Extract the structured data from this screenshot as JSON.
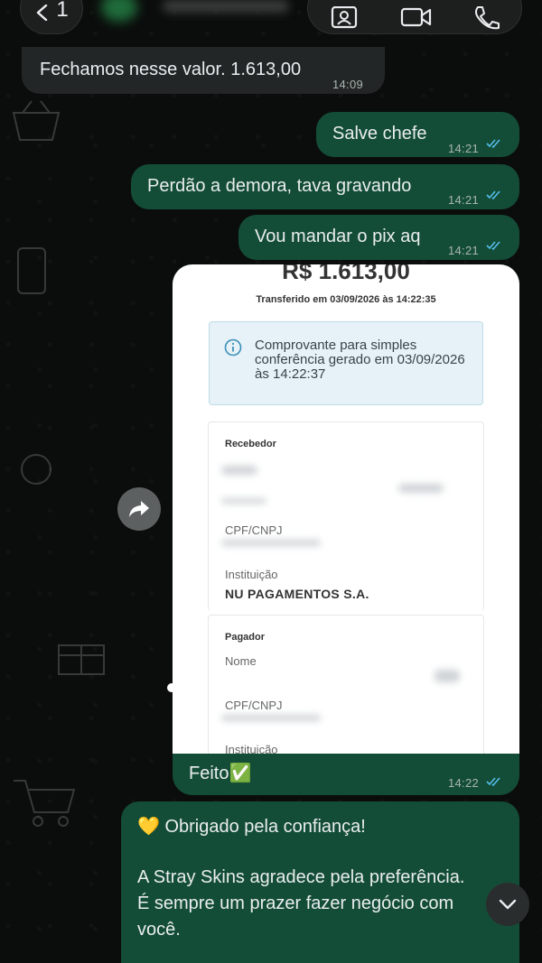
{
  "header": {
    "back_count": "1",
    "icons": [
      "chevron-left-icon",
      "contact-card-icon",
      "video-call-icon",
      "phone-call-icon"
    ]
  },
  "messages": [
    {
      "direction": "in",
      "text": "Fechamos nesse valor. 1.613,00",
      "time": "14:09"
    },
    {
      "direction": "out",
      "text": "Salve chefe",
      "time": "14:21",
      "status": "read"
    },
    {
      "direction": "out",
      "text": "Perdão a demora, tava gravando",
      "time": "14:21",
      "status": "read"
    },
    {
      "direction": "out",
      "text": "Vou mandar o pix aq",
      "time": "14:21",
      "status": "read"
    }
  ],
  "receipt": {
    "amount": "R$ 1.613,00",
    "transfer_date": "Transferido em 03/09/2026 às 14:22:35",
    "info_text": "Comprovante para simples conferência gerado em 03/09/2026 às 14:22:37",
    "recebedor": {
      "section": "Recebedor",
      "cpf_label": "CPF/CNPJ",
      "inst_label": "Instituição",
      "inst_value": "NU PAGAMENTOS S.A."
    },
    "pagador": {
      "section": "Pagador",
      "name_label": "Nome",
      "cpf_label": "CPF/CNPJ",
      "inst_label": "Instituição"
    },
    "caption": "Feito✅",
    "time": "14:22",
    "status": "read"
  },
  "last_message": {
    "line1": "💛 Obrigado pela confiança!",
    "line2": "A Stray Skins agradece pela preferência.",
    "line3": "É sempre um prazer fazer negócio com",
    "line4": "você."
  },
  "colors": {
    "outgoing_bubble": "#144d37",
    "incoming_bubble": "#232626",
    "read_ticks": "#53bdeb"
  }
}
